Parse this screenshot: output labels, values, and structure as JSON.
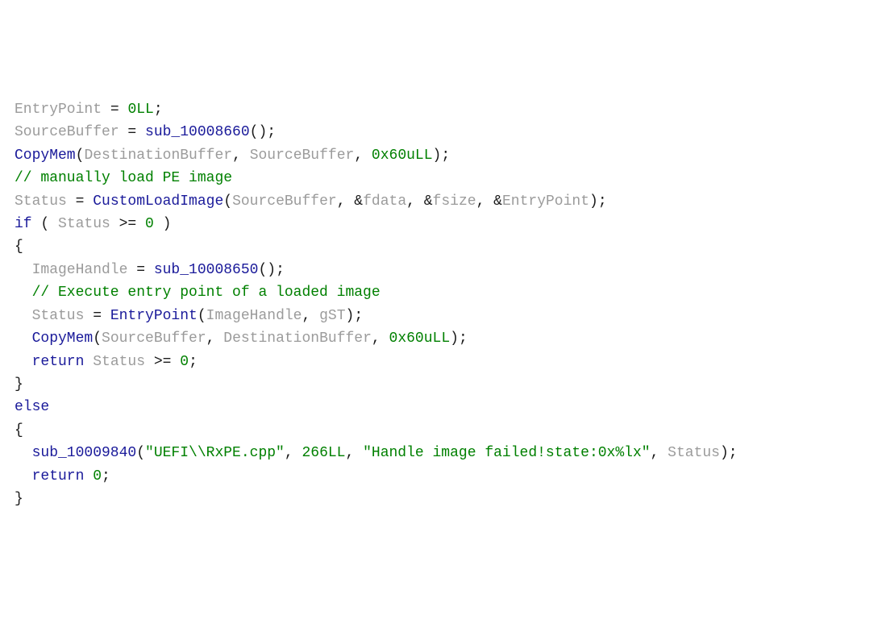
{
  "code": {
    "l1": {
      "id1": "EntryPoint",
      "eq": " = ",
      "num": "0LL",
      "semi": ";"
    },
    "l2": {
      "id1": "SourceBuffer",
      "eq": " = ",
      "fn": "sub_10008660",
      "paren": "()",
      "semi": ";"
    },
    "l3": {
      "fn": "CopyMem",
      "open": "(",
      "a1": "DestinationBuffer",
      "c1": ", ",
      "a2": "SourceBuffer",
      "c2": ", ",
      "num": "0x60uLL",
      "close": ")",
      "semi": ";"
    },
    "l4": {
      "comment": "// manually load PE image"
    },
    "l5": {
      "id1": "Status",
      "eq": " = ",
      "fn": "CustomLoadImage",
      "open": "(",
      "a1": "SourceBuffer",
      "c1": ", ",
      "amp1": "&",
      "a2": "fdata",
      "c2": ", ",
      "amp2": "&",
      "a3": "fsize",
      "c3": ", ",
      "amp3": "&",
      "a4": "EntryPoint",
      "close": ")",
      "semi": ";"
    },
    "l6": {
      "kw": "if",
      "sp": " ( ",
      "id": "Status",
      "op": " >= ",
      "num": "0",
      "close": " )"
    },
    "l7": {
      "brace": "{"
    },
    "l8": {
      "id1": "ImageHandle",
      "eq": " = ",
      "fn": "sub_10008650",
      "paren": "()",
      "semi": ";"
    },
    "l9": {
      "comment": "// Execute entry point of a loaded image"
    },
    "l10": {
      "id1": "Status",
      "eq": " = ",
      "fn": "EntryPoint",
      "open": "(",
      "a1": "ImageHandle",
      "c1": ", ",
      "a2": "gST",
      "close": ")",
      "semi": ";"
    },
    "l11": {
      "fn": "CopyMem",
      "open": "(",
      "a1": "SourceBuffer",
      "c1": ", ",
      "a2": "DestinationBuffer",
      "c2": ", ",
      "num": "0x60uLL",
      "close": ")",
      "semi": ";"
    },
    "l12": {
      "kw": "return",
      "sp": " ",
      "id": "Status",
      "op": " >= ",
      "num": "0",
      "semi": ";"
    },
    "l13": {
      "brace": "}"
    },
    "l14": {
      "kw": "else"
    },
    "l15": {
      "brace": "{"
    },
    "l16": {
      "fn": "sub_10009840",
      "open": "(",
      "s1": "\"UEFI\\\\RxPE.cpp\"",
      "c1": ", ",
      "num1": "266LL",
      "c2": ", ",
      "s2": "\"Handle image failed!state:0x%lx\"",
      "c3": ", ",
      "a4": "Status",
      "close": ")",
      "semi": ";"
    },
    "l17": {
      "kw": "return",
      "sp": " ",
      "num": "0",
      "semi": ";"
    },
    "l18": {
      "brace": "}"
    }
  }
}
